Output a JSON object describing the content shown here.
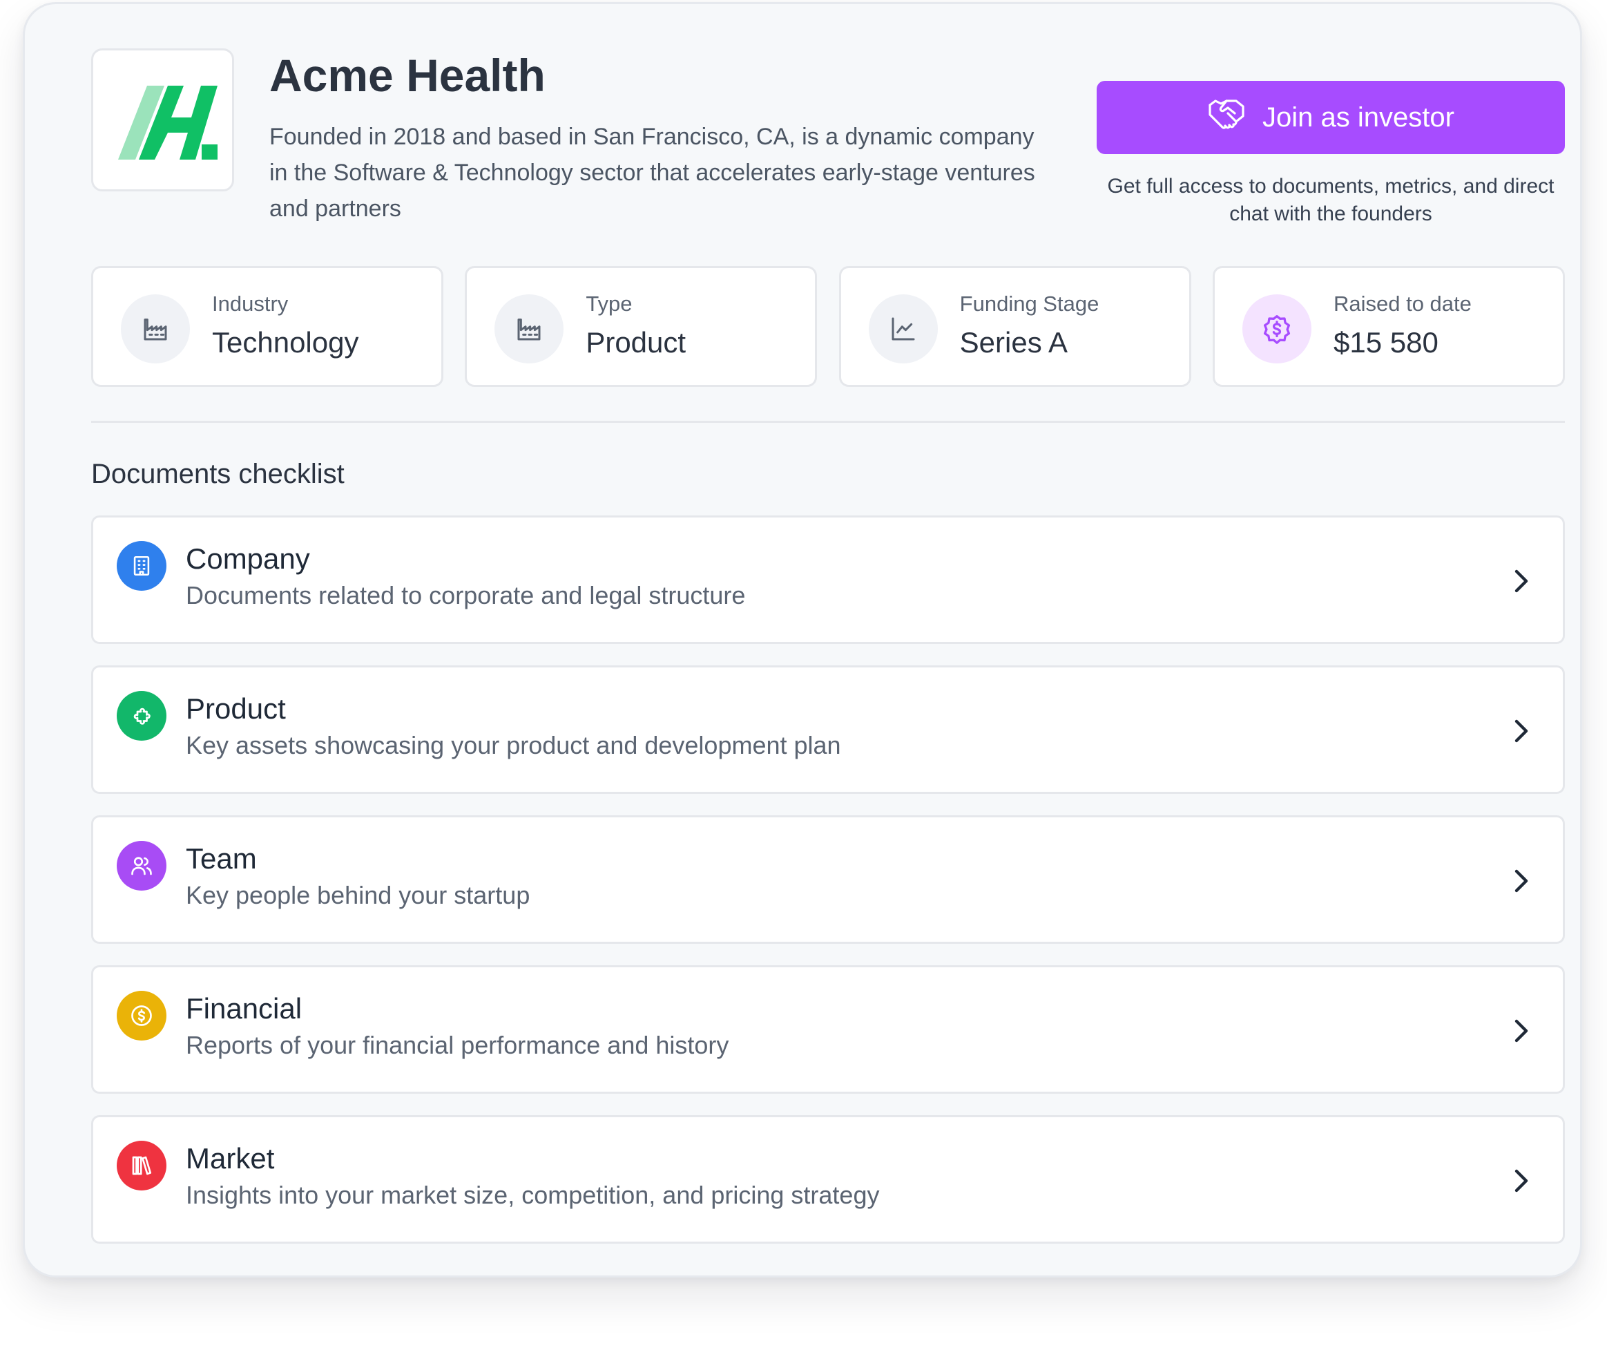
{
  "company": {
    "name": "Acme Health",
    "description": "Founded in 2018 and based in San Francisco, CA, is a dynamic company in the Software & Technology sector that accelerates early-stage ventures and partners",
    "logo_colors": {
      "light": "#9be3bb",
      "dark": "#10c065"
    }
  },
  "join": {
    "button_label": "Join as investor",
    "button_icon": "handshake-icon",
    "note": "Get full access to documents, metrics, and direct chat with the founders",
    "accent_color": "#a74cff"
  },
  "stats": [
    {
      "label": "Industry",
      "value": "Technology",
      "icon": "factory-icon"
    },
    {
      "label": "Type",
      "value": "Product",
      "icon": "factory-icon"
    },
    {
      "label": "Funding Stage",
      "value": "Series A",
      "icon": "line-chart-icon"
    },
    {
      "label": "Raised to date",
      "value": "$15 580",
      "icon": "dollar-badge-icon"
    }
  ],
  "documents": {
    "title": "Documents checklist",
    "items": [
      {
        "title": "Company",
        "subtitle": "Documents related to corporate and legal structure",
        "icon": "building-icon",
        "color": "#2f80ed"
      },
      {
        "title": "Product",
        "subtitle": "Key assets showcasing your product and development plan",
        "icon": "puzzle-icon",
        "color": "#12b76a"
      },
      {
        "title": "Team",
        "subtitle": "Key people behind your startup",
        "icon": "users-icon",
        "color": "#a84cf5"
      },
      {
        "title": "Financial",
        "subtitle": "Reports of your financial performance and history",
        "icon": "coin-icon",
        "color": "#eab308"
      },
      {
        "title": "Market",
        "subtitle": "Insights into your market size, competition, and pricing strategy",
        "icon": "library-icon",
        "color": "#ef3340"
      }
    ]
  }
}
